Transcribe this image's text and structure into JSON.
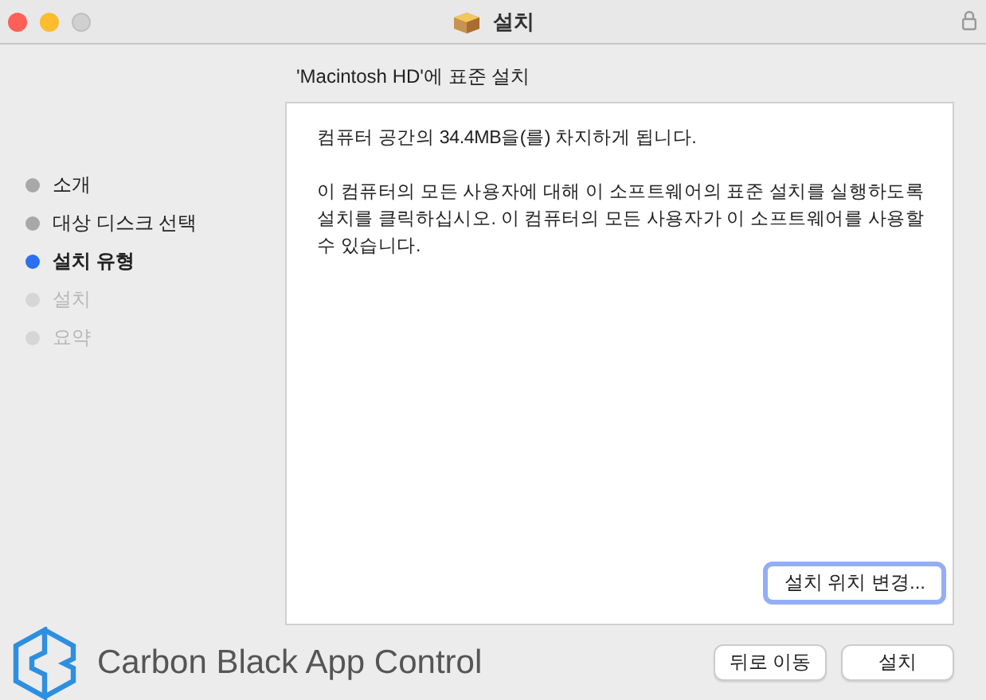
{
  "window": {
    "title": "설치"
  },
  "heading": "'Macintosh HD'에 표준 설치",
  "steps": [
    {
      "label": "소개",
      "selected": false,
      "disabled": false
    },
    {
      "label": "대상 디스크 선택",
      "selected": false,
      "disabled": false
    },
    {
      "label": "설치 유형",
      "selected": true,
      "disabled": false
    },
    {
      "label": "설치",
      "selected": false,
      "disabled": true
    },
    {
      "label": "요약",
      "selected": false,
      "disabled": true
    }
  ],
  "content": {
    "paragraphs": [
      "컴퓨터 공간의 34.4MB을(를) 차지하게 됩니다.",
      "이 컴퓨터의 모든 사용자에 대해 이 소프트웨어의 표준 설치를 실행하도록 설치를 클릭하십시오. 이 컴퓨터의 모든 사용자가 이 소프트웨어를 사용할 수 있습니다."
    ],
    "change_location_button": "설치 위치 변경..."
  },
  "brand": "Carbon Black App Control",
  "buttons": [
    "뒤로 이동",
    "설치"
  ]
}
